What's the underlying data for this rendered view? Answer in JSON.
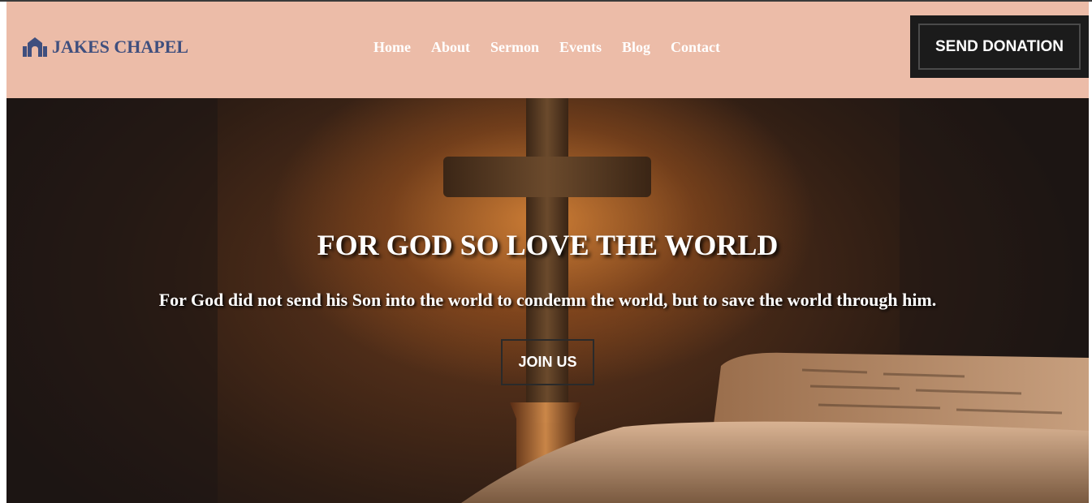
{
  "brand": {
    "name": "JAKES CHAPEL",
    "icon": "church-icon",
    "color": "#3f4f7e"
  },
  "nav": {
    "items": [
      {
        "label": "Home"
      },
      {
        "label": "About"
      },
      {
        "label": "Sermon"
      },
      {
        "label": "Events"
      },
      {
        "label": "Blog"
      },
      {
        "label": "Contact"
      }
    ]
  },
  "header": {
    "background": "#ecbca8",
    "donate_label": "SEND DONATION"
  },
  "hero": {
    "title": "FOR GOD SO LOVE THE WORLD",
    "subtitle": "For God did not send his Son into the world to condemn the world, but to save the world through him.",
    "cta_label": "JOIN US",
    "image": "cross-and-bible-image"
  }
}
